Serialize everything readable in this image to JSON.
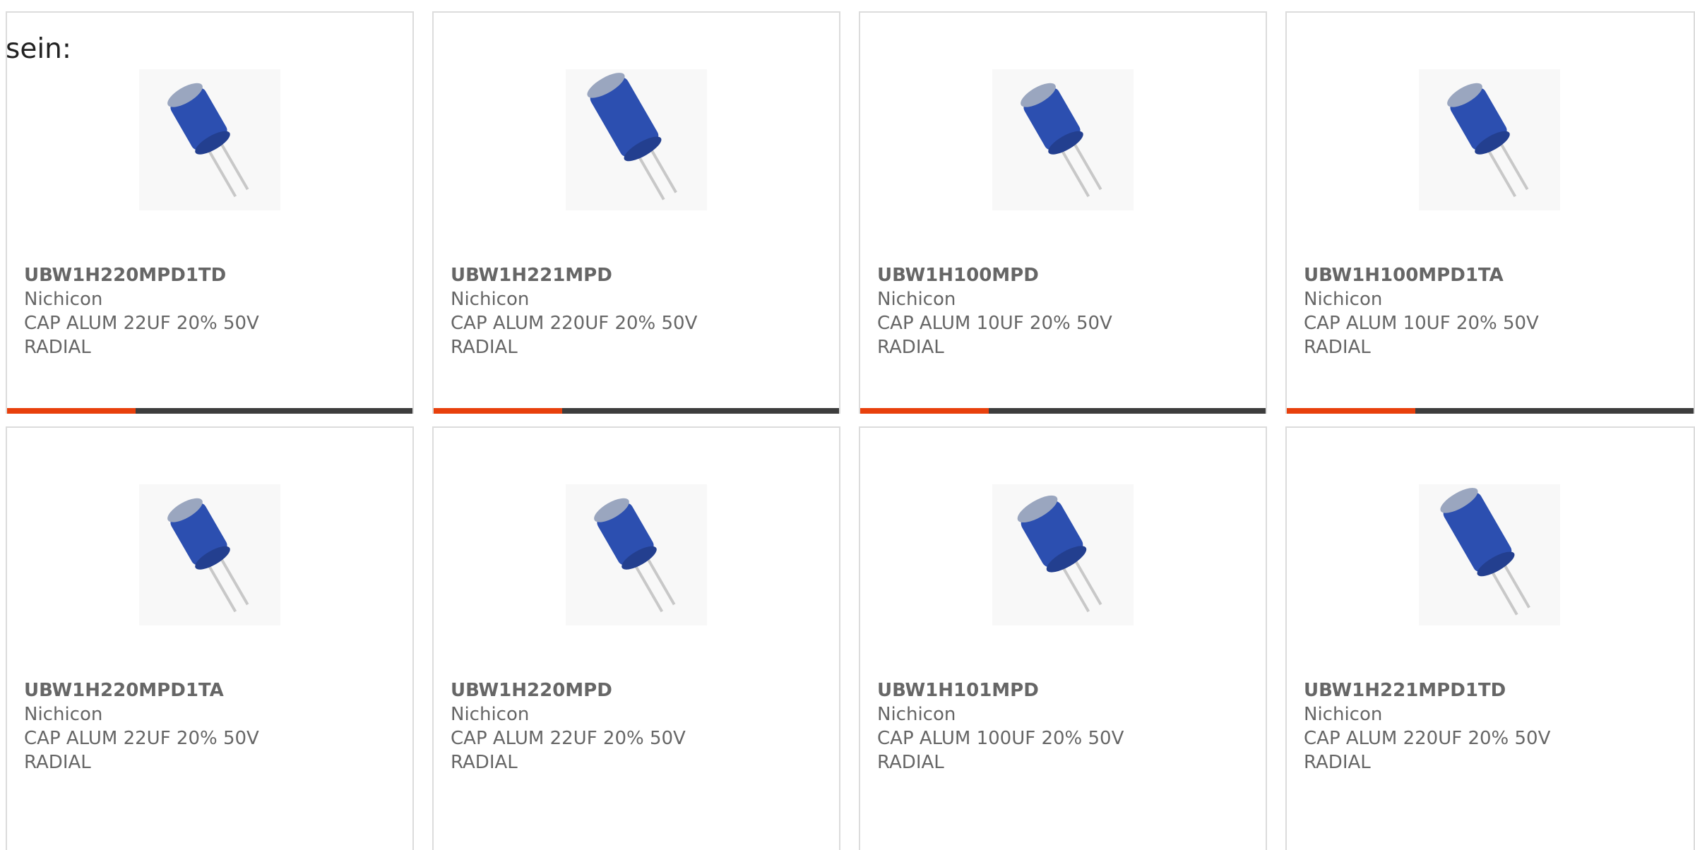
{
  "intro_text": "sein:",
  "colors": {
    "accent": "#e8400c",
    "bar": "#3d3d3d",
    "text": "#666666",
    "border": "#dcdcdc",
    "capacitor": "#2c4fb0"
  },
  "products": [
    {
      "part": "UBW1H220MPD1TD",
      "maker": "Nichicon",
      "desc1": "CAP ALUM 22UF 20% 50V",
      "desc2": "RADIAL",
      "image_icon": "capacitor-photo"
    },
    {
      "part": "UBW1H221MPD",
      "maker": "Nichicon",
      "desc1": "CAP ALUM 220UF 20% 50V",
      "desc2": "RADIAL",
      "image_icon": "capacitor-photo"
    },
    {
      "part": "UBW1H100MPD",
      "maker": "Nichicon",
      "desc1": "CAP ALUM 10UF 20% 50V",
      "desc2": "RADIAL",
      "image_icon": "capacitor-photo"
    },
    {
      "part": "UBW1H100MPD1TA",
      "maker": "Nichicon",
      "desc1": "CAP ALUM 10UF 20% 50V",
      "desc2": "RADIAL",
      "image_icon": "capacitor-photo"
    },
    {
      "part": "UBW1H220MPD1TA",
      "maker": "Nichicon",
      "desc1": "CAP ALUM 22UF 20% 50V",
      "desc2": "RADIAL",
      "image_icon": "capacitor-photo"
    },
    {
      "part": "UBW1H220MPD",
      "maker": "Nichicon",
      "desc1": "CAP ALUM 22UF 20% 50V",
      "desc2": "RADIAL",
      "image_icon": "capacitor-photo"
    },
    {
      "part": "UBW1H101MPD",
      "maker": "Nichicon",
      "desc1": "CAP ALUM 100UF 20% 50V",
      "desc2": "RADIAL",
      "image_icon": "capacitor-photo"
    },
    {
      "part": "UBW1H221MPD1TD",
      "maker": "Nichicon",
      "desc1": "CAP ALUM 220UF 20% 50V",
      "desc2": "RADIAL",
      "image_icon": "capacitor-photo"
    }
  ]
}
